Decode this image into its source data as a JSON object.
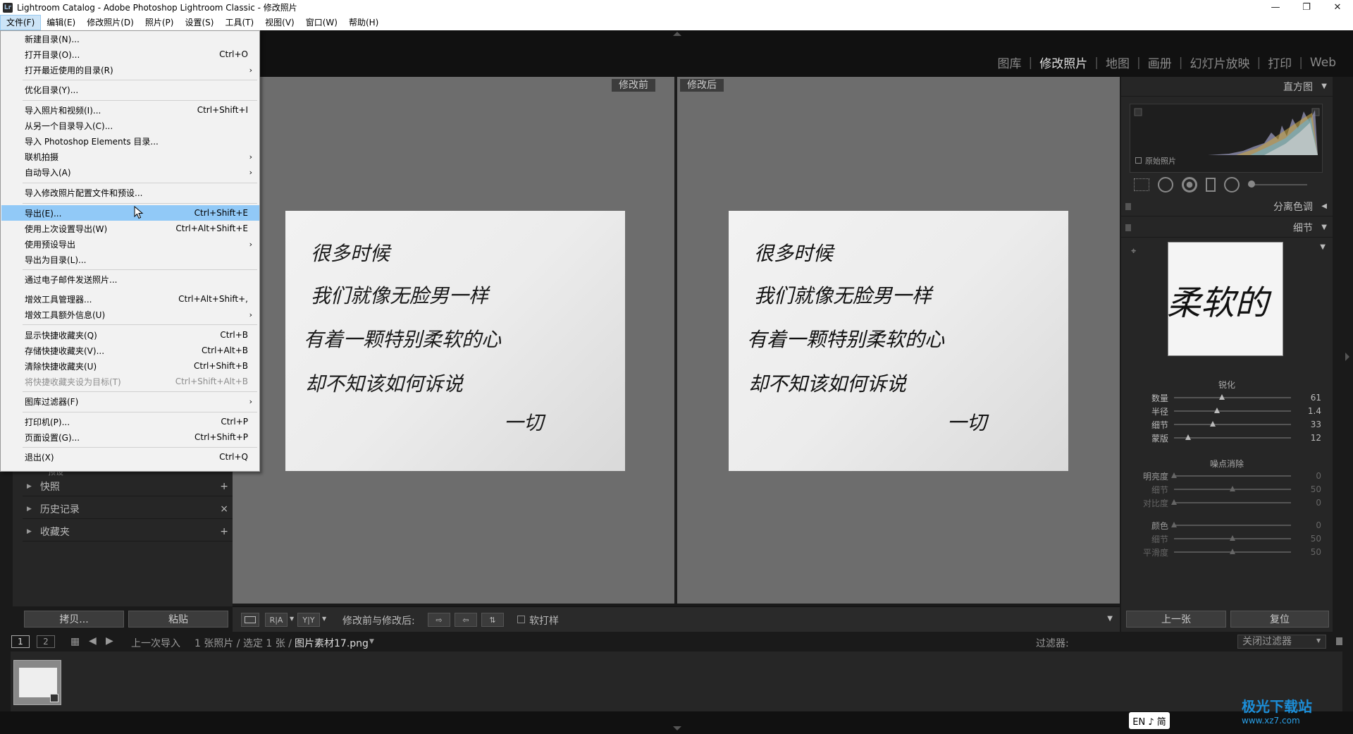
{
  "window": {
    "title": "Lightroom Catalog - Adobe Photoshop Lightroom Classic - 修改照片",
    "minimize": "—",
    "restore": "❐",
    "close": "✕"
  },
  "menubar": [
    {
      "label": "文件(F)"
    },
    {
      "label": "编辑(E)"
    },
    {
      "label": "修改照片(D)"
    },
    {
      "label": "照片(P)"
    },
    {
      "label": "设置(S)"
    },
    {
      "label": "工具(T)"
    },
    {
      "label": "视图(V)"
    },
    {
      "label": "窗口(W)"
    },
    {
      "label": "帮助(H)"
    }
  ],
  "modules": [
    "图库",
    "修改照片",
    "地图",
    "画册",
    "幻灯片放映",
    "打印",
    "Web"
  ],
  "file_menu": [
    {
      "label": "新建目录(N)...",
      "shortcut": ""
    },
    {
      "label": "打开目录(O)...",
      "shortcut": "Ctrl+O"
    },
    {
      "label": "打开最近使用的目录(R)",
      "shortcut": "",
      "submenu": true
    },
    {
      "label": "优化目录(Y)...",
      "shortcut": ""
    },
    {
      "label": "导入照片和视频(I)...",
      "shortcut": "Ctrl+Shift+I"
    },
    {
      "label": "从另一个目录导入(C)...",
      "shortcut": ""
    },
    {
      "label": "导入 Photoshop Elements 目录...",
      "shortcut": ""
    },
    {
      "label": "联机拍摄",
      "shortcut": "",
      "submenu": true
    },
    {
      "label": "自动导入(A)",
      "shortcut": "",
      "submenu": true
    },
    {
      "label": "导入修改照片配置文件和预设...",
      "shortcut": ""
    },
    {
      "label": "导出(E)...",
      "shortcut": "Ctrl+Shift+E",
      "highlighted": true
    },
    {
      "label": "使用上次设置导出(W)",
      "shortcut": "Ctrl+Alt+Shift+E"
    },
    {
      "label": "使用预设导出",
      "shortcut": "",
      "submenu": true
    },
    {
      "label": "导出为目录(L)...",
      "shortcut": ""
    },
    {
      "label": "通过电子邮件发送照片...",
      "shortcut": ""
    },
    {
      "label": "增效工具管理器...",
      "shortcut": "Ctrl+Alt+Shift+,"
    },
    {
      "label": "增效工具额外信息(U)",
      "shortcut": "",
      "submenu": true
    },
    {
      "label": "显示快捷收藏夹(Q)",
      "shortcut": "Ctrl+B"
    },
    {
      "label": "存储快捷收藏夹(V)...",
      "shortcut": "Ctrl+Alt+B"
    },
    {
      "label": "清除快捷收藏夹(U)",
      "shortcut": "Ctrl+Shift+B"
    },
    {
      "label": "将快捷收藏夹设为目标(T)",
      "shortcut": "Ctrl+Shift+Alt+B",
      "disabled": true
    },
    {
      "label": "图库过滤器(F)",
      "shortcut": "",
      "submenu": true
    },
    {
      "label": "打印机(P)...",
      "shortcut": "Ctrl+P"
    },
    {
      "label": "页面设置(G)...",
      "shortcut": "Ctrl+Shift+P"
    },
    {
      "label": "退出(X)",
      "shortcut": "Ctrl+Q"
    }
  ],
  "left_panel": {
    "hidden_label": "预设",
    "sections": [
      {
        "label": "快照",
        "action": "+"
      },
      {
        "label": "历史记录",
        "action": "×"
      },
      {
        "label": "收藏夹",
        "action": "+"
      }
    ],
    "copy_button": "拷贝...",
    "paste_button": "粘贴"
  },
  "viewer": {
    "before_label": "修改前",
    "after_label": "修改后"
  },
  "photo_text": [
    "很多时候",
    "我们就像无脸男一样",
    "有着一颗特别柔软的心",
    "却不知该如何诉说",
    "一切"
  ],
  "toolbar": {
    "ra": "R|A",
    "yy": "Y|Y",
    "before_after_label": "修改前与修改后:",
    "softproof_label": "软打样"
  },
  "right_panel": {
    "histogram_title": "直方图",
    "original_photo_label": "原始照片",
    "split_toning_title": "分离色调",
    "detail_title": "细节",
    "detail_preview_text": "柔软的",
    "sharpening_title": "锐化",
    "sharpening": [
      {
        "label": "数量",
        "value": "61",
        "fraction": 0.41
      },
      {
        "label": "半径",
        "value": "1.4",
        "fraction": 0.37
      },
      {
        "label": "细节",
        "value": "33",
        "fraction": 0.33
      },
      {
        "label": "蒙版",
        "value": "12",
        "fraction": 0.12
      }
    ],
    "noise_title": "噪点消除",
    "noise": [
      {
        "label": "明亮度",
        "value": "0",
        "fraction": 0.0
      },
      {
        "label": "细节",
        "value": "50",
        "fraction": 0.5
      },
      {
        "label": "对比度",
        "value": "0",
        "fraction": 0.0
      }
    ],
    "color_noise": [
      {
        "label": "颜色",
        "value": "0",
        "fraction": 0.0
      },
      {
        "label": "细节",
        "value": "50",
        "fraction": 0.5
      },
      {
        "label": "平滑度",
        "value": "50",
        "fraction": 0.5
      }
    ],
    "prev_button": "上一张",
    "reset_button": "复位"
  },
  "filmstrip_bar": {
    "page1": "1",
    "page2": "2",
    "source": "上一次导入",
    "count": "1 张照片 / 选定 1 张 /",
    "filename": "图片素材17.png",
    "filter_label": "过滤器:",
    "filter_value": "关闭过滤器"
  },
  "ime": "EN ♪ 简",
  "watermark": {
    "name": "极光下载站",
    "url": "www.xz7.com"
  }
}
